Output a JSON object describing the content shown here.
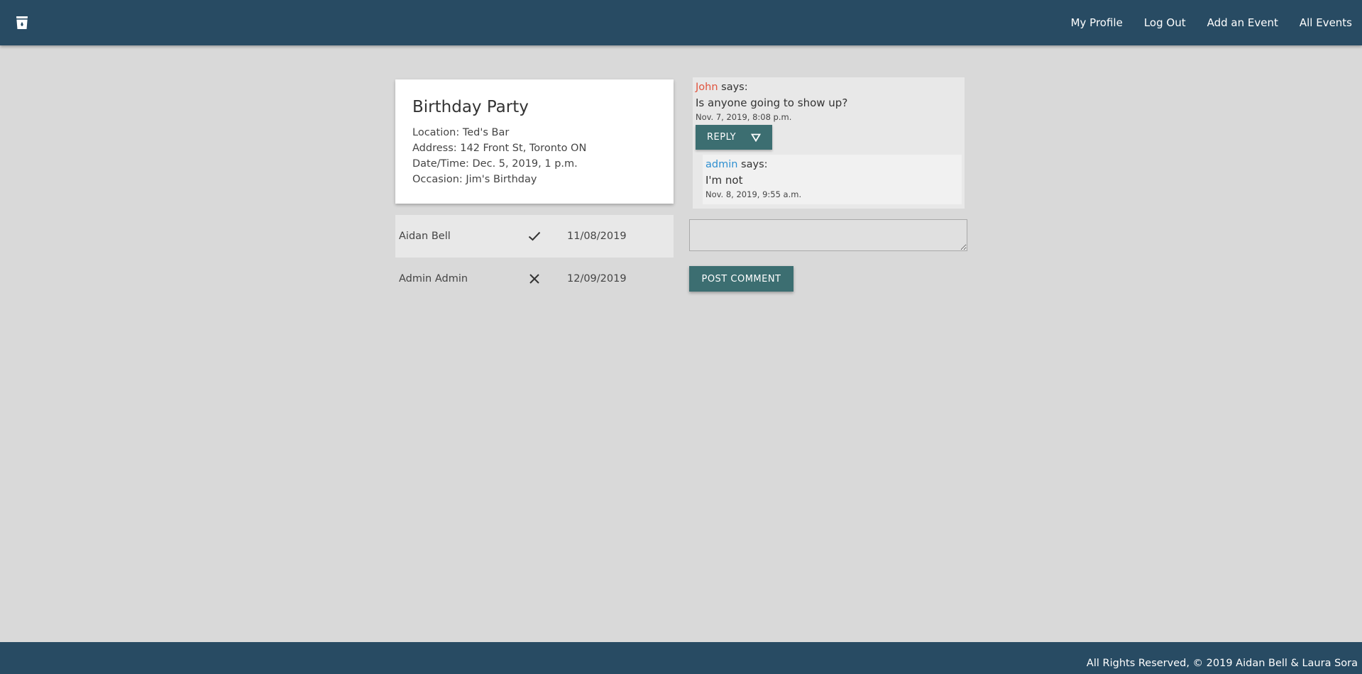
{
  "colors": {
    "navbar": "#284b63",
    "background": "#d9d9d9",
    "button": "#3c6e71",
    "author_john": "#e0533d",
    "author_admin": "#2e8fd0"
  },
  "nav": {
    "logo_icon": "cup-icon",
    "links": [
      "My Profile",
      "Log Out",
      "Add an Event",
      "All Events"
    ]
  },
  "event": {
    "title": "Birthday Party",
    "location": "Location: Ted's Bar",
    "address": "Address: 142 Front St, Toronto ON",
    "datetime": "Date/Time: Dec. 5, 2019, 1 p.m.",
    "occasion": "Occasion: Jim's Birthday"
  },
  "rsvps": [
    {
      "name": "Aidan Bell",
      "status_icon": "check-icon",
      "date": "11/08/2019"
    },
    {
      "name": "Admin Admin",
      "status_icon": "close-icon",
      "date": "12/09/2019"
    }
  ],
  "comments": [
    {
      "author": "John",
      "says": " says:",
      "text": "Is anyone going to show up?",
      "date": "Nov. 7, 2019, 8:08 p.m.",
      "reply_label": "REPLY",
      "replies": [
        {
          "author": "admin",
          "says": " says:",
          "text": "I'm not",
          "date": "Nov. 8, 2019, 9:55 a.m."
        }
      ]
    }
  ],
  "comment_form": {
    "placeholder": "",
    "submit_label": "POST COMMENT"
  },
  "footer": {
    "text": "All Rights Reserved, © 2019 Aidan Bell & Laura Sora"
  }
}
